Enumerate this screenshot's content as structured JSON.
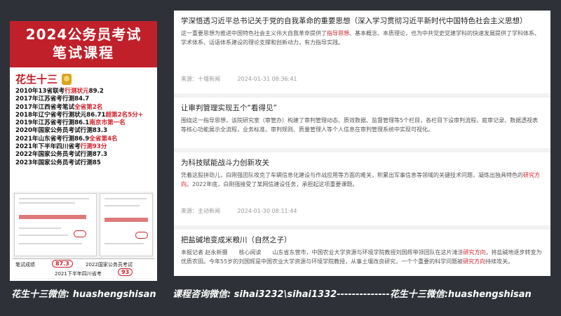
{
  "promo": {
    "title_line1": "2024公务员考试",
    "title_line2": "笔试课程",
    "teacher_name": "花生十三",
    "records": [
      {
        "text": "2010年13省联考",
        "hl": "行测状元",
        "tail": "89.2"
      },
      {
        "text": "2017年江苏省考行测84.7",
        "hl": "",
        "tail": ""
      },
      {
        "text": "2017年江西省考笔试",
        "hl": "全省第2名",
        "tail": ""
      },
      {
        "text": "2018年辽宁省考行测状元86.71",
        "hl": "超第2名5分+",
        "tail": ""
      },
      {
        "text": "2019年江苏省考行测86.1",
        "hl": "南京市第一名",
        "tail": ""
      },
      {
        "text": "2020年国家公务员考试行测83.3",
        "hl": "",
        "tail": ""
      },
      {
        "text": "2021年山东省考行测86.9",
        "hl": "全省第4名",
        "tail": ""
      },
      {
        "text": "2021年下半年四川省考",
        "hl": "行测93分",
        "tail": ""
      },
      {
        "text": "2022年国家公务员考试行测87.3",
        "hl": "",
        "tail": ""
      },
      {
        "text": "2023年国家公务员考试行测85",
        "hl": "",
        "tail": ""
      }
    ],
    "score_strip": {
      "label": "笔试成绩",
      "score1": "87.3",
      "exam1": "2022国家公务员考试",
      "score2": "93",
      "exam2": "2021下半年四川省考"
    }
  },
  "articles": [
    {
      "title": "学深悟透习近平总书记关于党的自我革命的重要思想（深入学习贯彻习近平新时代中国特色社会主义思想）",
      "body_pre": "这一重要思想为推进中国特色社会主义伟大自我革命提供了",
      "body_red": "指导思想",
      "body_post": "、基本概念、本质理论，也为中共党史党建学科的快速发展提供了学科体系、学术体系、话语体系建设的理论支撑和创新动力，有力指导实践。",
      "source": "来源：十堰新闻",
      "time": "2024-01-31 08:36:41"
    },
    {
      "title": "让审判管理实现五个“看得见”",
      "body_pre": "围绕这一指导思想，该院研究室（审管办）构建了审判管理动态、质效数据、监督管理等5个栏目，各栏目下设审判流程、庭审记录、数据透视表等核心功能展示全流程，业务标准、审判规则、质量管理人等个人信息在审判管理系统中实现可视化。",
      "body_red": "",
      "body_post": "",
      "source": "",
      "time": ""
    },
    {
      "title": "为科技赋能战斗力创新攻关",
      "body_pre": "凭着这股拼劲儿，白刚强团队攻克了车辆信息化建设与作战应用等方面的难关，积累出军事信息等领域的关键技术问题，凝炼出独具特色的",
      "body_red": "研究方向",
      "body_post": "。2022年底，白刚强接受了某网信建设任务，承担起这项重要课题。",
      "source": "来源：主动新闻",
      "time": "2024-01-30 08:11:44"
    },
    {
      "title": "把盐碱地变成米粮川（自然之子）",
      "body_pre": "本报记者 赵永新摄　　核心阅读　　山东省东营市，中国农业大学资源与环境学院教授刘国辉带领团队在这片滩涂",
      "body_red": "研究方向",
      "body_post": "，将盐碱地逐步转变为优质农田。今年55岁的刘国辉是中国农业大学资源与环境学院教授，从事土壤改良研究，一个个重要的科学问题被",
      "body_red2": "研究方向",
      "body_post2": "持续攻关。",
      "source": "",
      "time": ""
    }
  ],
  "footer": {
    "left": "花生十三微信: huashengshisan",
    "right": "课程咨询微信: sihai3232\\sihai1332--------------花生十三微信:huashengshisan"
  },
  "colors": {
    "accent_red": "#c0202a",
    "background": "#2e3238"
  }
}
